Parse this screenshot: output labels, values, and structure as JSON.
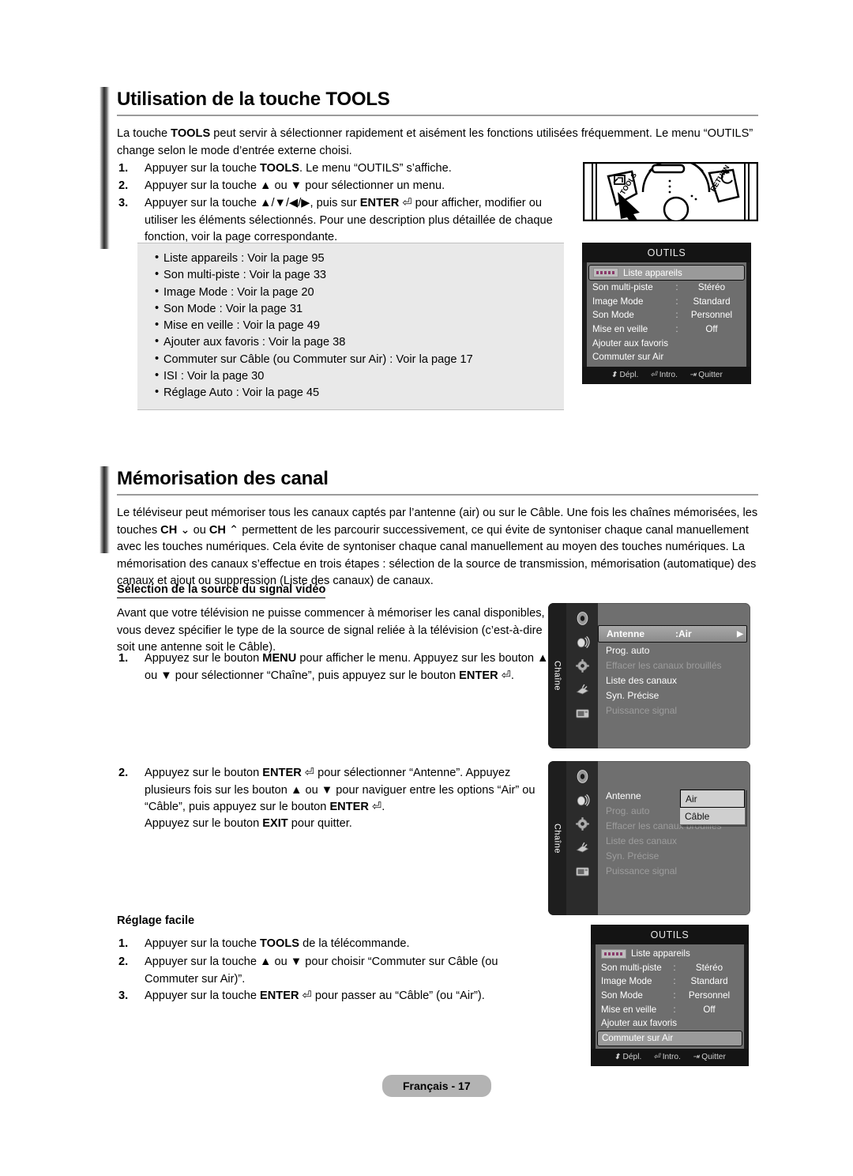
{
  "page": {
    "footer_label": "Français - 17"
  },
  "section1": {
    "title": "Utilisation de la touche TOOLS",
    "intro": "La touche TOOLS peut servir à sélectionner rapidement et aisément les fonctions utilisées fréquemment. Le menu “OUTILS” change selon le mode d’entrée externe choisi.",
    "steps": [
      {
        "num": "1.",
        "text": "Appuyer sur la touche TOOLS. Le menu “OUTILS” s’affiche."
      },
      {
        "num": "2.",
        "text": "Appuyer sur la touche ▲ ou ▼ pour sélectionner un menu."
      },
      {
        "num": "3.",
        "text": "Appuyer sur la touche ▲/▼/◀/▶, puis sur ENTER ⏎ pour afficher, modifier ou utiliser les éléments sélectionnés. Pour une description plus détaillée de chaque fonction, voir la page correspondante."
      }
    ],
    "feature_list": [
      "Liste appareils : Voir la page 95",
      "Son multi-piste : Voir la page 33",
      "Image Mode : Voir la page 20",
      "Son Mode : Voir la page 31",
      "Mise en veille : Voir la page 49",
      "Ajouter aux favoris : Voir la page 38",
      "Commuter sur Câble (ou Commuter sur Air) : Voir la page 17",
      "ISI : Voir la page 30",
      "Réglage Auto : Voir la page 45"
    ]
  },
  "remote": {
    "tools_label": "TOOLS",
    "return_label": "RETURN"
  },
  "osd_top": {
    "title": "OUTILS",
    "rows": [
      {
        "label": "Liste appareils",
        "colon": "",
        "value": "",
        "selected": true,
        "badge": true
      },
      {
        "label": "Son multi-piste",
        "colon": ":",
        "value": "Stéréo",
        "selected": false,
        "badge": false
      },
      {
        "label": "Image Mode",
        "colon": ":",
        "value": "Standard",
        "selected": false,
        "badge": false
      },
      {
        "label": "Son Mode",
        "colon": ":",
        "value": "Personnel",
        "selected": false,
        "badge": false
      },
      {
        "label": "Mise en veille",
        "colon": ":",
        "value": "Off",
        "selected": false,
        "badge": false
      },
      {
        "label": "Ajouter aux favoris",
        "colon": "",
        "value": "",
        "selected": false,
        "badge": false
      },
      {
        "label": "Commuter sur Air",
        "colon": "",
        "value": "",
        "selected": false,
        "badge": false
      }
    ],
    "footer": [
      {
        "icon": "⬍",
        "label": "Dépl."
      },
      {
        "icon": "⏎",
        "label": "Intro."
      },
      {
        "icon": "⇥",
        "label": "Quitter"
      }
    ]
  },
  "osd_bottom": {
    "title": "OUTILS",
    "rows": [
      {
        "label": "Liste appareils",
        "colon": "",
        "value": "",
        "selected": false,
        "badge": true
      },
      {
        "label": "Son multi-piste",
        "colon": ":",
        "value": "Stéréo",
        "selected": false,
        "badge": false
      },
      {
        "label": "Image Mode",
        "colon": ":",
        "value": "Standard",
        "selected": false,
        "badge": false
      },
      {
        "label": "Son Mode",
        "colon": ":",
        "value": "Personnel",
        "selected": false,
        "badge": false
      },
      {
        "label": "Mise en veille",
        "colon": ":",
        "value": "Off",
        "selected": false,
        "badge": false
      },
      {
        "label": "Ajouter aux favoris",
        "colon": "",
        "value": "",
        "selected": false,
        "badge": false
      },
      {
        "label": "Commuter sur Air",
        "colon": "",
        "value": "",
        "selected": true,
        "badge": false
      }
    ],
    "footer": [
      {
        "icon": "⬍",
        "label": "Dépl."
      },
      {
        "icon": "⏎",
        "label": "Intro."
      },
      {
        "icon": "⇥",
        "label": "Quitter"
      }
    ]
  },
  "section2": {
    "title": "Mémorisation des canal",
    "intro": "Le téléviseur peut mémoriser tous les canaux captés par l’antenne (air) ou sur le Câble. Une fois les chaînes mémorisées, les touches CH ⌄ ou CH ⌃ permettent de les parcourir successivement, ce qui évite de syntoniser chaque canal manuellement avec les touches numériques. Cela évite de syntoniser chaque canal manuellement au moyen des touches numériques. La mémorisation des canaux s’effectue en trois étapes : sélection de la source de transmission, mémorisation (automatique) des canaux et ajout ou suppression (Liste des canaux) de canaux.",
    "subheading": "Sélection de la source du signal vidéo",
    "lead": "Avant que votre télévision ne puisse commencer à mémoriser les canal disponibles, vous devez spécifier le type de la source de signal reliée à la télévision (c’est-à-dire soit une antenne soit le Câble).",
    "steps": [
      {
        "num": "1.",
        "text": "Appuyez sur le bouton MENU pour afficher le menu. Appuyez sur les bouton ▲ ou ▼ pour sélectionner “Chaîne”, puis appuyez sur le bouton ENTER ⏎."
      },
      {
        "num": "2.",
        "text": "Appuyez sur le bouton ENTER ⏎ pour sélectionner “Antenne”. Appuyez plusieurs fois sur les bouton ▲ ou ▼ pour naviguer entre les options “Air” ou “Câble”, puis appuyez sur le bouton ENTER ⏎."
      }
    ],
    "exit_note": "Appuyez sur le bouton EXIT pour quitter."
  },
  "tvmenu1": {
    "side_label": "Chaîne",
    "rows": [
      {
        "label": "Antenne",
        "value": ":Air",
        "selected": true,
        "dim": false,
        "arrow": "▶"
      },
      {
        "label": "Prog. auto",
        "value": "",
        "selected": false,
        "dim": false,
        "arrow": ""
      },
      {
        "label": "Effacer les canaux brouillés",
        "value": "",
        "selected": false,
        "dim": true,
        "arrow": ""
      },
      {
        "label": "Liste des canaux",
        "value": "",
        "selected": false,
        "dim": false,
        "arrow": ""
      },
      {
        "label": "Syn. Précise",
        "value": "",
        "selected": false,
        "dim": false,
        "arrow": ""
      },
      {
        "label": "Puissance signal",
        "value": "",
        "selected": false,
        "dim": true,
        "arrow": ""
      }
    ]
  },
  "tvmenu2": {
    "side_label": "Chaîne",
    "rows": [
      {
        "label": "Antenne",
        "value": ":",
        "selected": false,
        "dim": false,
        "arrow": ""
      },
      {
        "label": "Prog. auto",
        "value": "",
        "selected": false,
        "dim": true,
        "arrow": ""
      },
      {
        "label": "Effacer les canaux brouillés",
        "value": "",
        "selected": false,
        "dim": true,
        "arrow": ""
      },
      {
        "label": "Liste des canaux",
        "value": "",
        "selected": false,
        "dim": true,
        "arrow": ""
      },
      {
        "label": "Syn. Précise",
        "value": "",
        "selected": false,
        "dim": true,
        "arrow": ""
      },
      {
        "label": "Puissance signal",
        "value": "",
        "selected": false,
        "dim": true,
        "arrow": ""
      }
    ],
    "dropdown": [
      {
        "label": "Air",
        "selected": true
      },
      {
        "label": "Câble",
        "selected": false
      }
    ]
  },
  "section3": {
    "heading": "Réglage facile",
    "steps": [
      {
        "num": "1.",
        "text": "Appuyer sur la touche TOOLS de la télécommande."
      },
      {
        "num": "2.",
        "text": "Appuyer sur la touche ▲ ou ▼ pour choisir “Commuter sur Câble (ou Commuter sur Air)”."
      },
      {
        "num": "3.",
        "text": "Appuyer sur la touche ENTER ⏎ pour passer au “Câble” (ou “Air”)."
      }
    ]
  }
}
